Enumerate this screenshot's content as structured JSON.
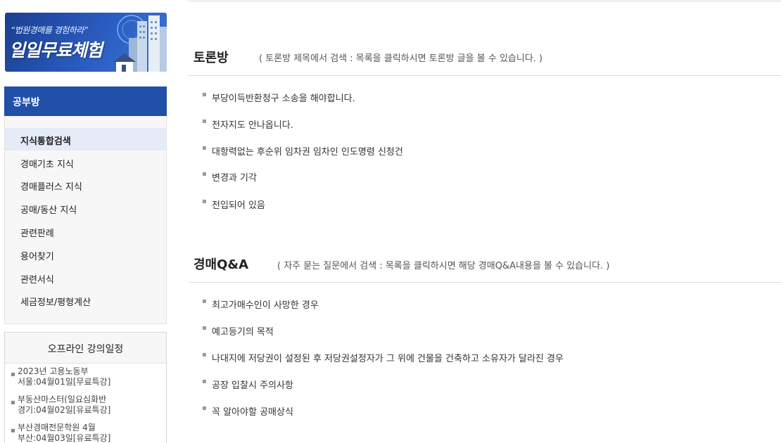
{
  "banner": {
    "subtitle": "“법원경매를 경험하라”",
    "title": "일일무료체험"
  },
  "sidebar": {
    "header": "공부방",
    "items": [
      {
        "label": "지식통합검색",
        "active": true
      },
      {
        "label": "경매기초 지식",
        "active": false
      },
      {
        "label": "경매플러스 지식",
        "active": false
      },
      {
        "label": "공매/동산 지식",
        "active": false
      },
      {
        "label": "관련판례",
        "active": false
      },
      {
        "label": "용어찾기",
        "active": false
      },
      {
        "label": "관련서식",
        "active": false
      },
      {
        "label": "세금정보/평형계산",
        "active": false
      }
    ]
  },
  "lectures": {
    "title": "오프라인 강의일정",
    "items": [
      {
        "line1": "2023년 고용노동부",
        "line2": "서울:04월01일[무료특강]"
      },
      {
        "line1": "부동산마스터(일요심화반",
        "line2": "경기:04월02일[유료특강]"
      },
      {
        "line1": "부산경매전문학원 4월",
        "line2": "부산:04월03일[유료특강]"
      }
    ]
  },
  "forum": {
    "title": "토론방",
    "description": "( 토론방 제목에서 검색 : 목록을 클릭하시면 토론방 글을 볼 수 있습니다. )",
    "items": [
      "부당이득반환청구 소송을 해야합니다.",
      "전자지도 안나옵니다.",
      "대항력없는 후순위 임차권 임차인 인도명령 신청건",
      "변경과 기각",
      "전입되어 있음"
    ]
  },
  "qa": {
    "title": "경매Q&A",
    "description": "( 자주 묻는 질문에서 검색 : 목록을 클릭하시면 해당 경매Q&A내용을 볼 수 있습니다. )",
    "items": [
      "최고가매수인이 사망한 경우",
      "예고등기의 목적",
      "나대지에 저당권이 설정된 후 저당권설정자가 그 위에 건물을 건축하고 소유자가 달라진 경우",
      "공장 입찰시 주의사항",
      "꼭 알아야할 공매상식"
    ]
  },
  "colors": {
    "accent": "#2150a8",
    "active_bg": "#e4ecf7"
  }
}
